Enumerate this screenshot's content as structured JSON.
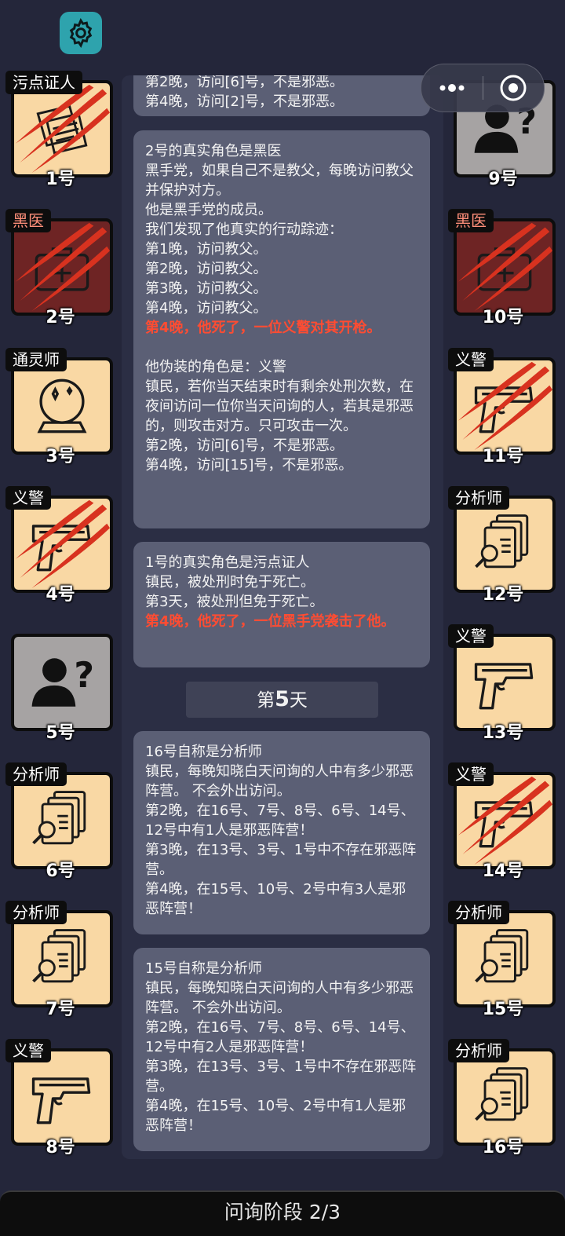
{
  "header": {
    "settings_icon": "gear-icon"
  },
  "capsule": {
    "more_icon": "more-dots-icon",
    "close_icon": "target-close-icon"
  },
  "players_left": [
    {
      "num": "1号",
      "role": "污点证人",
      "role_color": "white",
      "icon": "papers-icon",
      "dead": true
    },
    {
      "num": "2号",
      "role": "黑医",
      "role_color": "red",
      "icon": "doctor-bag-icon",
      "dead": true
    },
    {
      "num": "3号",
      "role": "通灵师",
      "role_color": "white",
      "icon": "crystal-ball-icon",
      "dead": false
    },
    {
      "num": "4号",
      "role": "义警",
      "role_color": "white",
      "icon": "pistol-icon",
      "dead": true
    },
    {
      "num": "5号",
      "role": "",
      "role_color": "white",
      "icon": "unknown-person-icon",
      "dead": false
    },
    {
      "num": "6号",
      "role": "分析师",
      "role_color": "white",
      "icon": "documents-search-icon",
      "dead": false
    },
    {
      "num": "7号",
      "role": "分析师",
      "role_color": "white",
      "icon": "documents-search-icon",
      "dead": false
    },
    {
      "num": "8号",
      "role": "义警",
      "role_color": "white",
      "icon": "pistol-icon",
      "dead": false
    }
  ],
  "players_right": [
    {
      "num": "9号",
      "role": "",
      "role_color": "white",
      "icon": "unknown-person-icon",
      "dead": false
    },
    {
      "num": "10号",
      "role": "黑医",
      "role_color": "red",
      "icon": "doctor-bag-icon",
      "dead": true
    },
    {
      "num": "11号",
      "role": "义警",
      "role_color": "white",
      "icon": "pistol-icon",
      "dead": true
    },
    {
      "num": "12号",
      "role": "分析师",
      "role_color": "white",
      "icon": "documents-search-icon",
      "dead": false
    },
    {
      "num": "13号",
      "role": "义警",
      "role_color": "white",
      "icon": "pistol-icon",
      "dead": false
    },
    {
      "num": "14号",
      "role": "义警",
      "role_color": "white",
      "icon": "pistol-icon",
      "dead": true
    },
    {
      "num": "15号",
      "role": "分析师",
      "role_color": "white",
      "icon": "documents-search-icon",
      "dead": false
    },
    {
      "num": "16号",
      "role": "分析师",
      "role_color": "white",
      "icon": "documents-search-icon",
      "dead": false
    }
  ],
  "log": {
    "top_partial": [
      "第2晚，访问[6]号，不是邪恶。",
      "第4晚，访问[2]号，不是邪恶。"
    ],
    "entry_2": [
      {
        "text": "2号的真实角色是黑医",
        "red": false
      },
      {
        "text": "黑手党，如果自己不是教父，每晚访问教父并保护对方。",
        "red": false
      },
      {
        "text": "他是黑手党的成员。",
        "red": false
      },
      {
        "text": "我们发现了他真实的行动踪迹：",
        "red": false
      },
      {
        "text": "第1晚，访问教父。",
        "red": false
      },
      {
        "text": "第2晚，访问教父。",
        "red": false
      },
      {
        "text": "第3晚，访问教父。",
        "red": false
      },
      {
        "text": "第4晚，访问教父。",
        "red": false
      },
      {
        "text": "第4晚，他死了，一位义警对其开枪。",
        "red": true
      },
      {
        "text": " ",
        "red": false
      },
      {
        "text": "他伪装的角色是：义警",
        "red": false
      },
      {
        "text": "镇民，若你当天结束时有剩余处刑次数，在夜间访问一位你当天问询的人，若其是邪恶的，则攻击对方。只可攻击一次。",
        "red": false
      },
      {
        "text": "第2晚，访问[6]号，不是邪恶。",
        "red": false
      },
      {
        "text": "第4晚，访问[15]号，不是邪恶。",
        "red": false
      }
    ],
    "entry_1": [
      {
        "text": "1号的真实角色是污点证人",
        "red": false
      },
      {
        "text": "镇民，被处刑时免于死亡。",
        "red": false
      },
      {
        "text": "第3天，被处刑但免于死亡。",
        "red": false
      },
      {
        "text": "第4晚，他死了，一位黑手党袭击了他。",
        "red": true
      }
    ],
    "day_header": {
      "prefix": "第",
      "number": "5",
      "suffix": "天"
    },
    "entry_16": [
      {
        "text": "16号自称是分析师",
        "red": false
      },
      {
        "text": "镇民，每晚知晓白天问询的人中有多少邪恶阵营。 不会外出访问。",
        "red": false
      },
      {
        "text": "第2晚，在16号、7号、8号、6号、14号、12号中有1人是邪恶阵营！",
        "red": false
      },
      {
        "text": "第3晚，在13号、3号、1号中不存在邪恶阵营。",
        "red": false
      },
      {
        "text": "第4晚，在15号、10号、2号中有3人是邪恶阵营！",
        "red": false
      }
    ],
    "entry_15": [
      {
        "text": "15号自称是分析师",
        "red": false
      },
      {
        "text": "镇民，每晚知晓白天问询的人中有多少邪恶阵营。 不会外出访问。",
        "red": false
      },
      {
        "text": "第2晚，在16号、7号、8号、6号、14号、12号中有2人是邪恶阵营！",
        "red": false
      },
      {
        "text": "第3晚，在13号、3号、1号中不存在邪恶阵营。",
        "red": false
      },
      {
        "text": "第4晚，在15号、10号、2号中有1人是邪恶阵营！",
        "red": false
      }
    ]
  },
  "footer": {
    "phase_label": "问询阶段 2/3"
  },
  "colors": {
    "card_bg": "#f9d8a4",
    "red_text": "#ff4c32",
    "teal": "#2ea3ad",
    "slash_red": "#d8321f"
  }
}
